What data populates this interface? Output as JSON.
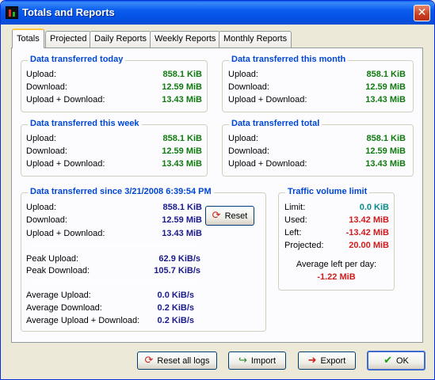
{
  "window": {
    "title": "Totals and Reports",
    "close_glyph": "✕"
  },
  "tabs": [
    {
      "label": "Totals",
      "active": true
    },
    {
      "label": "Projected"
    },
    {
      "label": "Daily Reports"
    },
    {
      "label": "Weekly Reports"
    },
    {
      "label": "Monthly Reports"
    }
  ],
  "groups": {
    "today": {
      "title": "Data transferred today",
      "rows": [
        {
          "label": "Upload:",
          "value": "858.1 KiB"
        },
        {
          "label": "Download:",
          "value": "12.59 MiB"
        },
        {
          "label": "Upload + Download:",
          "value": "13.43 MiB"
        }
      ]
    },
    "month": {
      "title": "Data transferred this month",
      "rows": [
        {
          "label": "Upload:",
          "value": "858.1 KiB"
        },
        {
          "label": "Download:",
          "value": "12.59 MiB"
        },
        {
          "label": "Upload + Download:",
          "value": "13.43 MiB"
        }
      ]
    },
    "week": {
      "title": "Data transferred this week",
      "rows": [
        {
          "label": "Upload:",
          "value": "858.1 KiB"
        },
        {
          "label": "Download:",
          "value": "12.59 MiB"
        },
        {
          "label": "Upload + Download:",
          "value": "13.43 MiB"
        }
      ]
    },
    "total": {
      "title": "Data transferred total",
      "rows": [
        {
          "label": "Upload:",
          "value": "858.1 KiB"
        },
        {
          "label": "Download:",
          "value": "12.59 MiB"
        },
        {
          "label": "Upload + Download:",
          "value": "13.43 MiB"
        }
      ]
    },
    "since": {
      "title": "Data transferred since 3/21/2008 6:39:54 PM",
      "rows": [
        {
          "label": "Upload:",
          "value": "858.1 KiB"
        },
        {
          "label": "Download:",
          "value": "12.59 MiB"
        },
        {
          "label": "Upload + Download:",
          "value": "13.43 MiB"
        }
      ],
      "peak": [
        {
          "label": "Peak Upload:",
          "value": "62.9 KiB/s"
        },
        {
          "label": "Peak Download:",
          "value": "105.7 KiB/s"
        }
      ],
      "average": [
        {
          "label": "Average Upload:",
          "value": "0.0 KiB/s"
        },
        {
          "label": "Average Download:",
          "value": "0.2 KiB/s"
        },
        {
          "label": "Average Upload + Download:",
          "value": "0.2 KiB/s"
        }
      ],
      "reset_label": "Reset"
    },
    "limit": {
      "title": "Traffic volume limit",
      "rows": [
        {
          "label": "Limit:",
          "value": "0.0 KiB"
        },
        {
          "label": "Used:",
          "value": "13.42 MiB"
        },
        {
          "label": "Left:",
          "value": "-13.42 MiB"
        },
        {
          "label": "Projected:",
          "value": "20.00 MiB"
        }
      ],
      "avg_left_label": "Average left per day:",
      "avg_left_value": "-1.22 MiB"
    }
  },
  "buttons": {
    "reset_all": "Reset all logs",
    "import": "Import",
    "export": "Export",
    "ok": "OK"
  },
  "colors": {
    "accent": "#0046d5",
    "green": "#0f7a0f",
    "blue": "#1a1a8c",
    "red": "#d11a1a",
    "teal": "#0b8a8a"
  }
}
